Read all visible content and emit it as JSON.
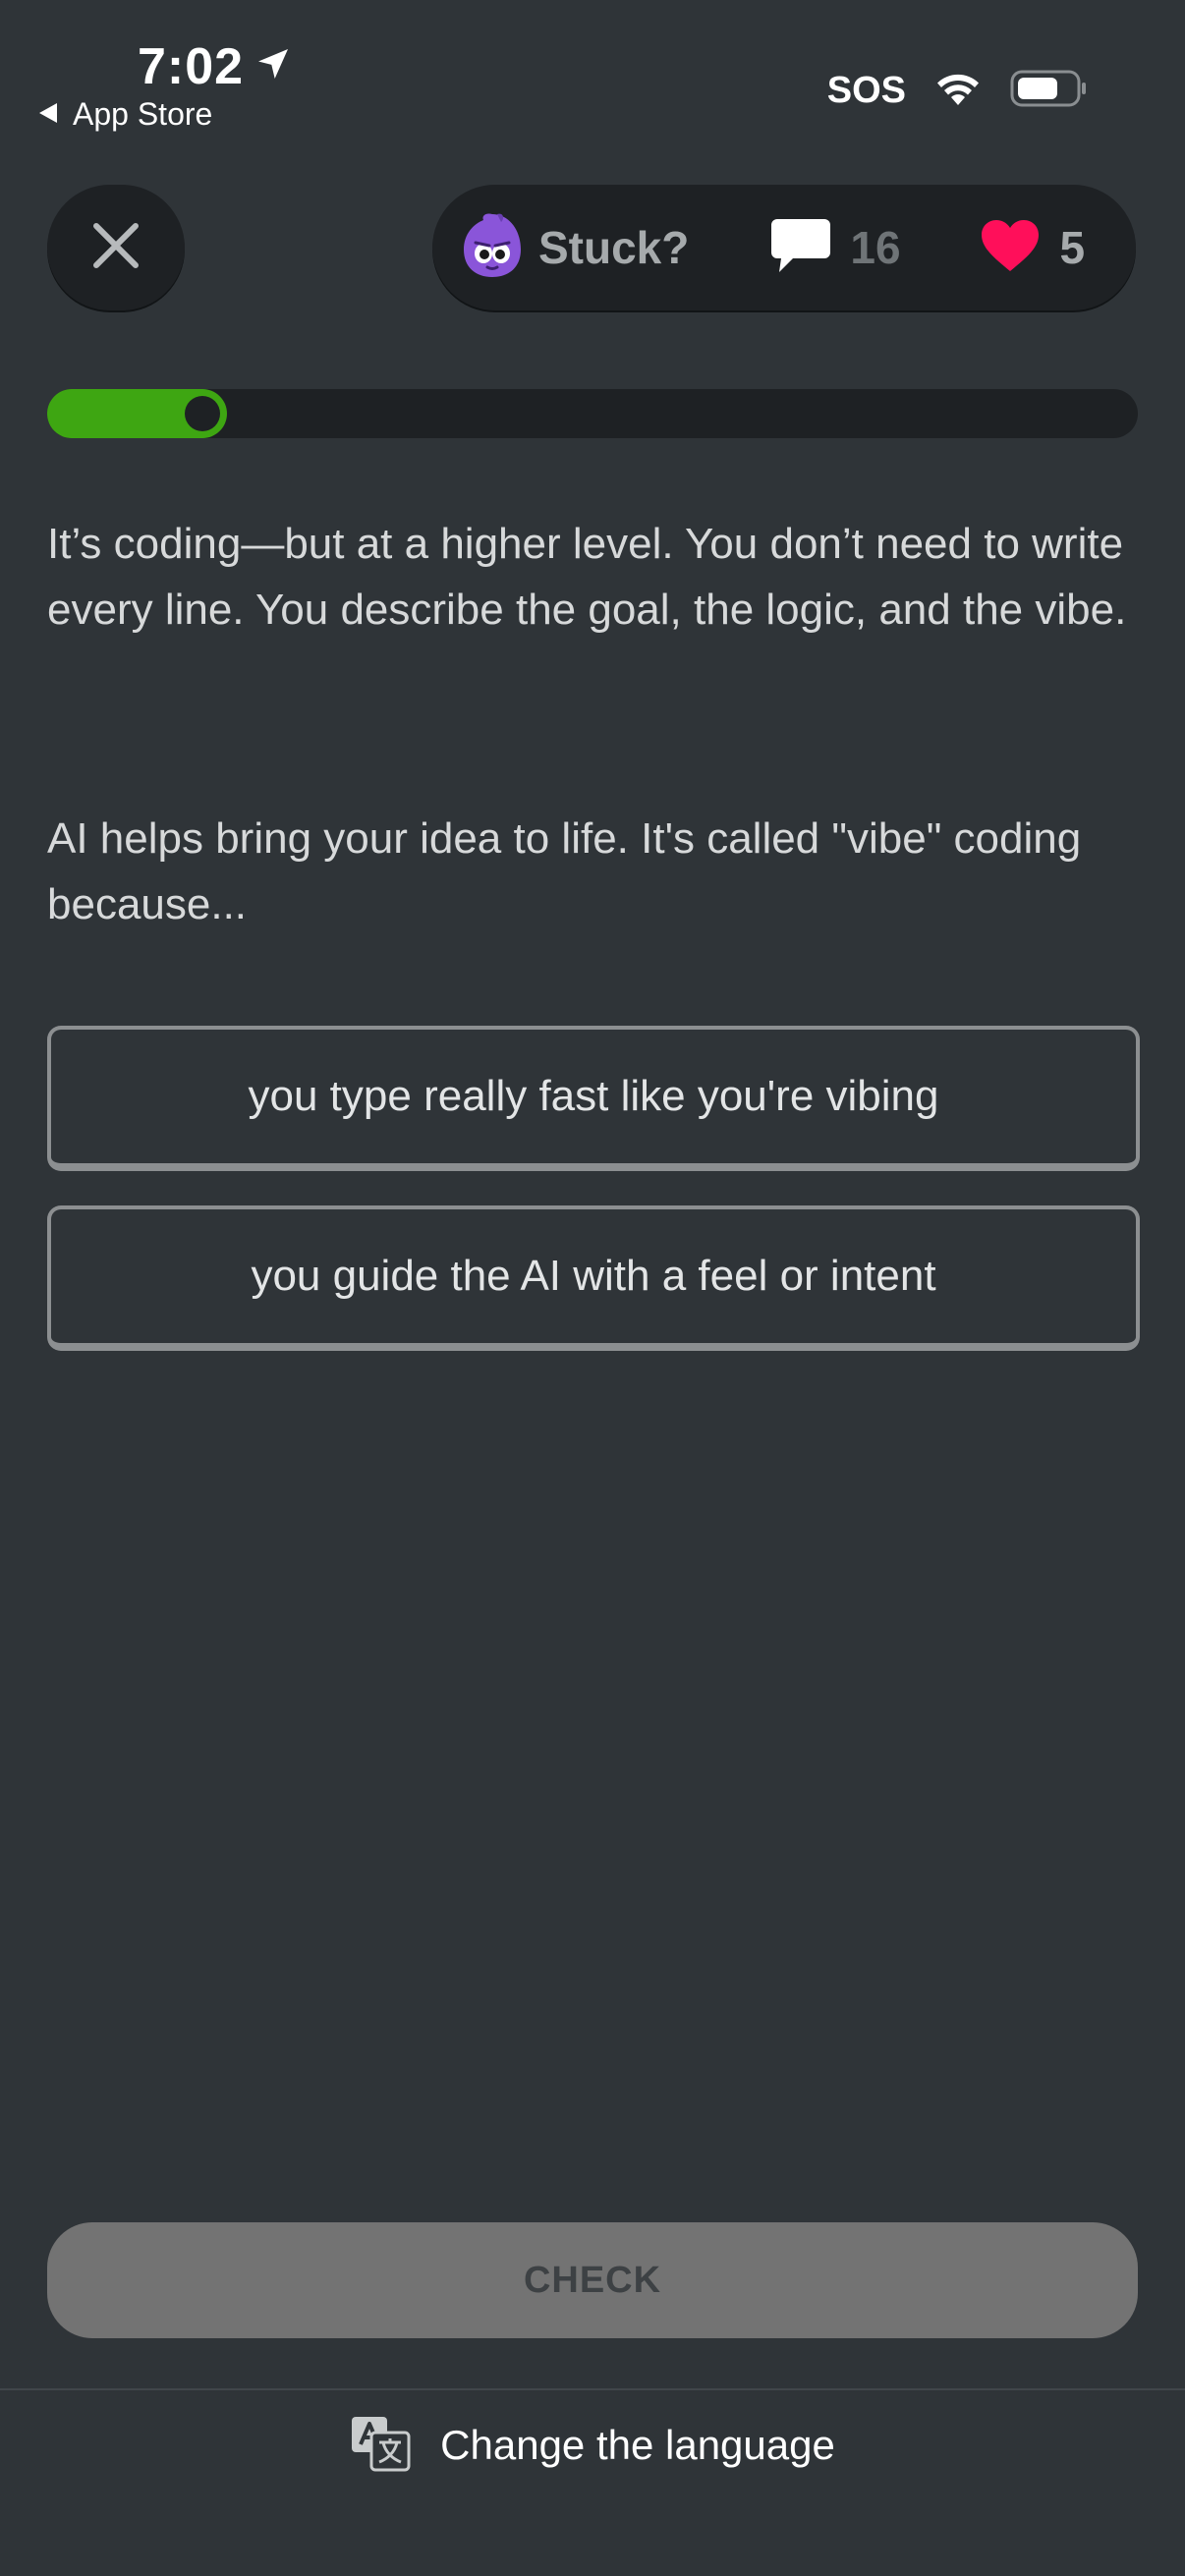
{
  "status_bar": {
    "time": "7:02",
    "back_label": "App Store",
    "sos": "SOS",
    "icons": [
      "location-arrow-icon",
      "wifi-icon",
      "battery-icon",
      "back-triangle-icon"
    ]
  },
  "header": {
    "close_icon": "close-icon",
    "stuck_label": "Stuck?",
    "streak_count": "16",
    "hearts_count": "5",
    "icons": [
      "mascot-avatar-icon",
      "speech-bubble-icon",
      "heart-icon"
    ]
  },
  "progress": {
    "fraction": 0.165,
    "fill_color": "#3ea612",
    "track_color": "#1e2124"
  },
  "lesson": {
    "paragraph1": "It’s coding—but at a higher level. You don’t need to write every line. You describe the goal, the logic, and the vibe.",
    "paragraph2": "AI helps bring your idea to life. It's called \"vibe\" coding because..."
  },
  "options": [
    {
      "label": "you type really fast like you're vibing"
    },
    {
      "label": "you guide the AI with a feel or intent"
    }
  ],
  "footer": {
    "check_label": "CHECK",
    "language_label": "Change the language",
    "language_icon": "translate-icon"
  },
  "colors": {
    "background": "#2f3438",
    "heart": "#ff0f5a",
    "mascot": "#8a55d9",
    "accent_green": "#3ea612",
    "check_button": "#737373"
  }
}
